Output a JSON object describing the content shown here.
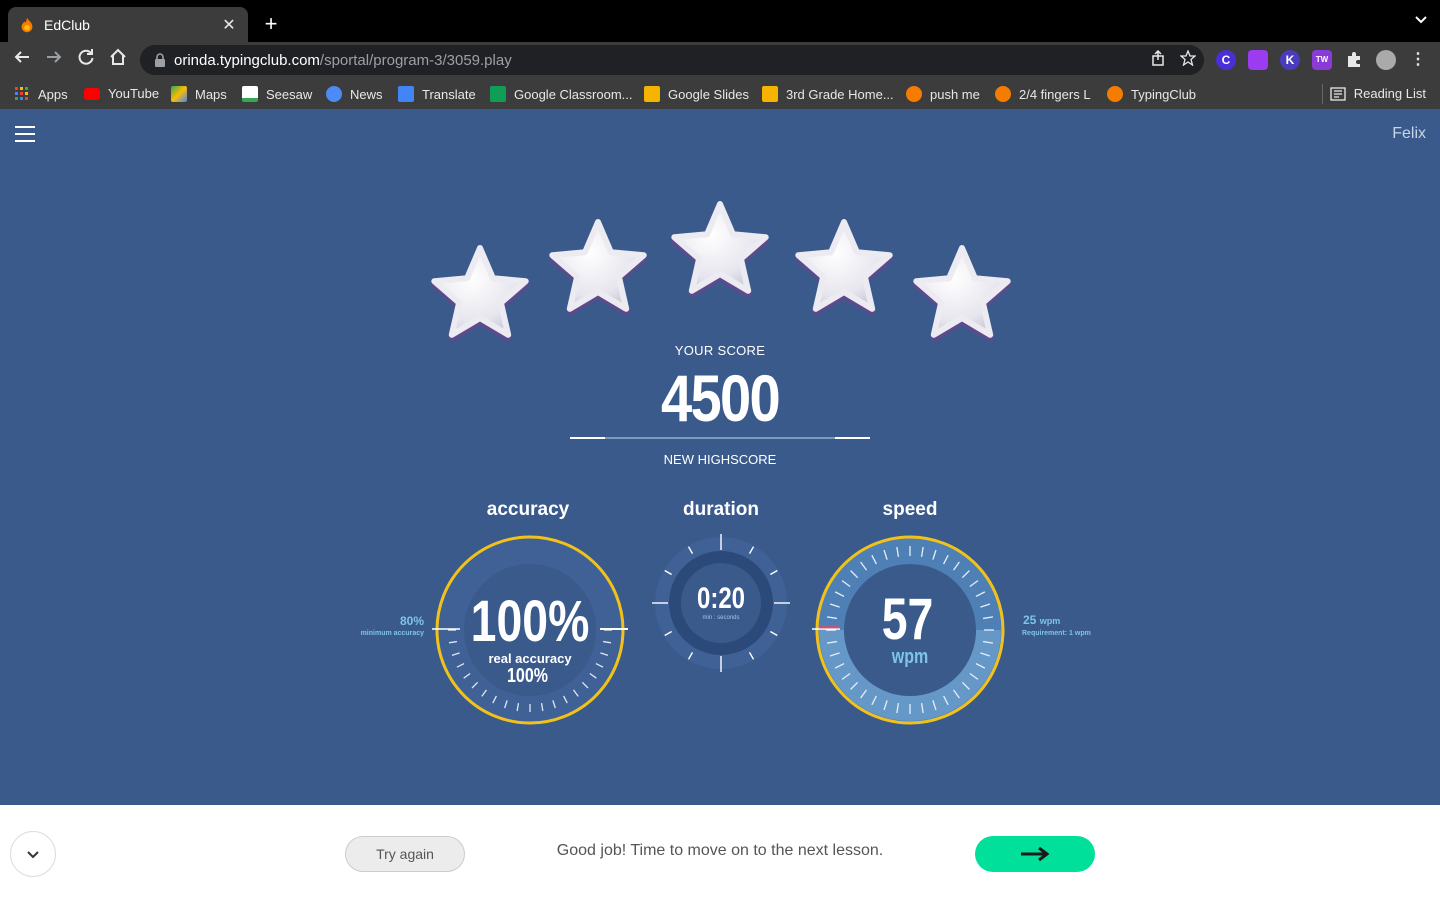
{
  "browser": {
    "tab_title": "EdClub",
    "tab_close": "✕",
    "new_tab": "+",
    "url_host": "orinda.typingclub.com",
    "url_path": "/sportal/program-3/3059.play",
    "bookmarks": [
      {
        "label": "Apps",
        "color": "#4285f4"
      },
      {
        "label": "YouTube",
        "color": "#ff0000"
      },
      {
        "label": "Maps",
        "color": "#34a853"
      },
      {
        "label": "Seesaw",
        "color": "#ffffff"
      },
      {
        "label": "News",
        "color": "#4c8bf5"
      },
      {
        "label": "Translate",
        "color": "#4285f4"
      },
      {
        "label": "Google Classroom...",
        "color": "#0f9d58"
      },
      {
        "label": "Google Slides",
        "color": "#f4b400"
      },
      {
        "label": "3rd Grade Home...",
        "color": "#f4b400"
      },
      {
        "label": "push me",
        "color": "#f57c00"
      },
      {
        "label": "2/4 fingers L",
        "color": "#f57c00"
      },
      {
        "label": "TypingClub",
        "color": "#f57c00"
      }
    ],
    "reading_list": "Reading List"
  },
  "page": {
    "user_name": "Felix",
    "stars": 5,
    "score_label": "YOUR SCORE",
    "score": "4500",
    "highscore_label": "NEW HIGHSCORE",
    "accuracy": {
      "title": "accuracy",
      "value": "100%",
      "real_label": "real accuracy",
      "real_value": "100%",
      "min_value": "80%",
      "min_label": "minimum accuracy",
      "fraction": 1.0
    },
    "duration": {
      "title": "duration",
      "value": "0:20",
      "unit_label": "min : seconds"
    },
    "speed": {
      "title": "speed",
      "value": "57",
      "unit": "wpm",
      "req_value": "25",
      "req_unit": "wpm",
      "req_label": "Requirement: 1 wpm"
    }
  },
  "footer": {
    "collapse_icon": "chevron-down-icon",
    "try_again": "Try again",
    "message": "Good job! Time to move on to the next lesson.",
    "next_icon": "arrow-right-icon"
  },
  "colors": {
    "page_bg": "#3a5a8c",
    "gauge_ring": "#f2c21b",
    "gauge_fill": "#3f6196",
    "accent_blue": "#7ec4ea",
    "next_btn": "#00e09a"
  }
}
